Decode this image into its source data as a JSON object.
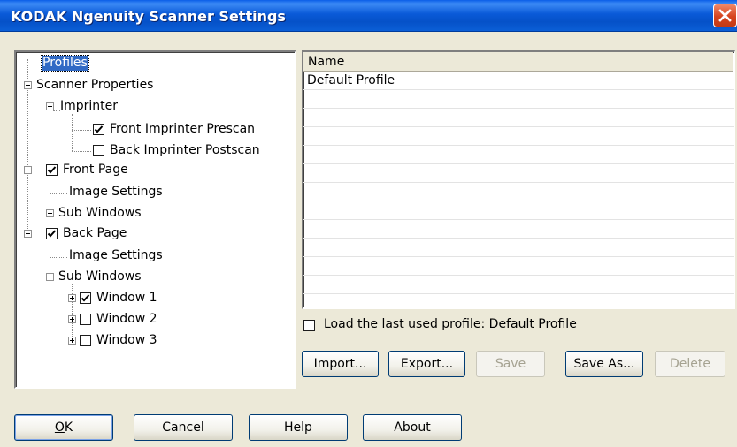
{
  "window": {
    "title": "KODAK Ngenuity Scanner Settings",
    "close_icon": "close-x"
  },
  "tree": {
    "items": [
      {
        "label": "Profiles",
        "selected": true
      },
      {
        "label": "Scanner Properties",
        "expanded": true
      },
      {
        "label": "Imprinter",
        "expanded": true
      },
      {
        "label": "Front Imprinter Prescan",
        "checked": true
      },
      {
        "label": "Back Imprinter Postscan",
        "checked": false
      },
      {
        "label": "Front Page",
        "checked": true,
        "expanded": true
      },
      {
        "label": "Image Settings"
      },
      {
        "label": "Sub Windows",
        "expanded": false
      },
      {
        "label": "Back Page",
        "checked": true,
        "expanded": true
      },
      {
        "label": "Image Settings"
      },
      {
        "label": "Sub Windows",
        "expanded": true
      },
      {
        "label": "Window 1",
        "checked": true,
        "expanded": false
      },
      {
        "label": "Window 2",
        "checked": false,
        "expanded": false
      },
      {
        "label": "Window 3",
        "checked": false,
        "expanded": false
      }
    ]
  },
  "profiles": {
    "column_header": "Name",
    "rows": [
      "Default Profile"
    ],
    "load_last_label": "Load the last used profile: Default Profile",
    "load_last_checked": false
  },
  "profile_buttons": {
    "import": "Import...",
    "export": "Export...",
    "save": "Save",
    "save_as": "Save As...",
    "delete": "Delete"
  },
  "dialog_buttons": {
    "ok_accel": "O",
    "ok_rest": "K",
    "cancel": "Cancel",
    "help": "Help",
    "about": "About"
  },
  "colors": {
    "titlebar": "#0a5ad8",
    "selection": "#316ac5",
    "dialog_bg": "#ece9d8"
  }
}
